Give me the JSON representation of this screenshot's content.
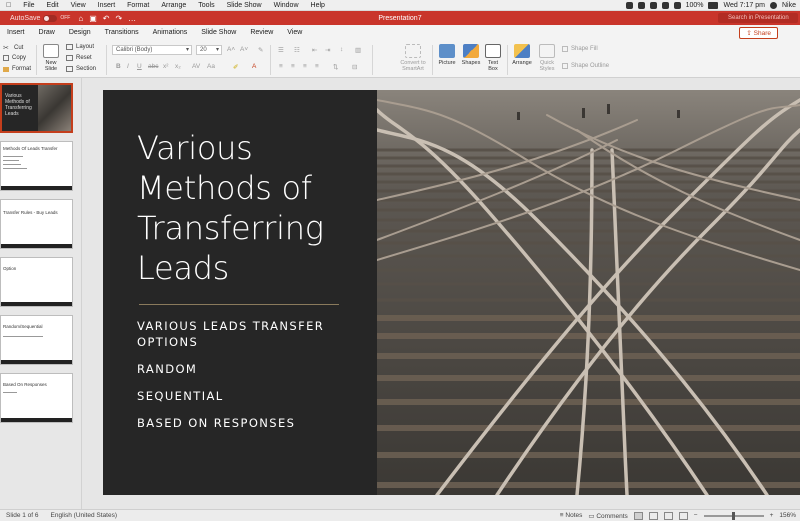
{
  "menubar": {
    "items": [
      "File",
      "Edit",
      "View",
      "Insert",
      "Format",
      "Arrange",
      "Tools",
      "Slide Show",
      "Window",
      "Help"
    ],
    "battery": "100%",
    "clock": "Wed 7:17 pm",
    "user": "Nike"
  },
  "titlebar": {
    "autosave_label": "AutoSave",
    "autosave_state": "OFF",
    "document_title": "Presentation7",
    "search_placeholder": "Search in Presentation",
    "accent_color": "#c9352b"
  },
  "tabs": {
    "items": [
      "Insert",
      "Draw",
      "Design",
      "Transitions",
      "Animations",
      "Slide Show",
      "Review",
      "View"
    ],
    "share_label": "Share"
  },
  "ribbon": {
    "cut": "Cut",
    "copy": "Copy",
    "format": "Format",
    "new_slide": [
      "New",
      "Slide"
    ],
    "layout": "Layout",
    "reset": "Reset",
    "section": "Section",
    "font_name": "Calibri (Body)",
    "font_size": "20",
    "convert_smartart": [
      "Convert to",
      "SmartArt"
    ],
    "picture": "Picture",
    "shapes": "Shapes",
    "text_box": [
      "Text",
      "Box"
    ],
    "arrange": "Arrange",
    "quick_styles": [
      "Quick",
      "Styles"
    ],
    "shape_fill": "Shape Fill",
    "shape_outline": "Shape Outline"
  },
  "thumbnails": [
    {
      "number": "1",
      "title": "Various Methods of Transferring Leads",
      "selected": true
    },
    {
      "number": "2",
      "title": "Methods Of Leads Transfer",
      "selected": false
    },
    {
      "number": "3",
      "title": "Transfer Rules - Buy Leads",
      "selected": false
    },
    {
      "number": "4",
      "title": "Option",
      "selected": false
    },
    {
      "number": "5",
      "title": "Random/Sequential",
      "selected": false
    },
    {
      "number": "6",
      "title": "Based On Responses",
      "selected": false
    }
  ],
  "slide": {
    "title": "Various Methods of Transferring Leads",
    "bullets": [
      "VARIOUS LEADS TRANSFER OPTIONS",
      "RANDOM",
      "SEQUENTIAL",
      "BASED ON RESPONSES"
    ],
    "image": "railway-track-junction-photo"
  },
  "statusbar": {
    "slide_indicator": "Slide 1 of 6",
    "language": "English (United States)",
    "notes": "Notes",
    "comments": "Comments",
    "zoom": "156%"
  }
}
